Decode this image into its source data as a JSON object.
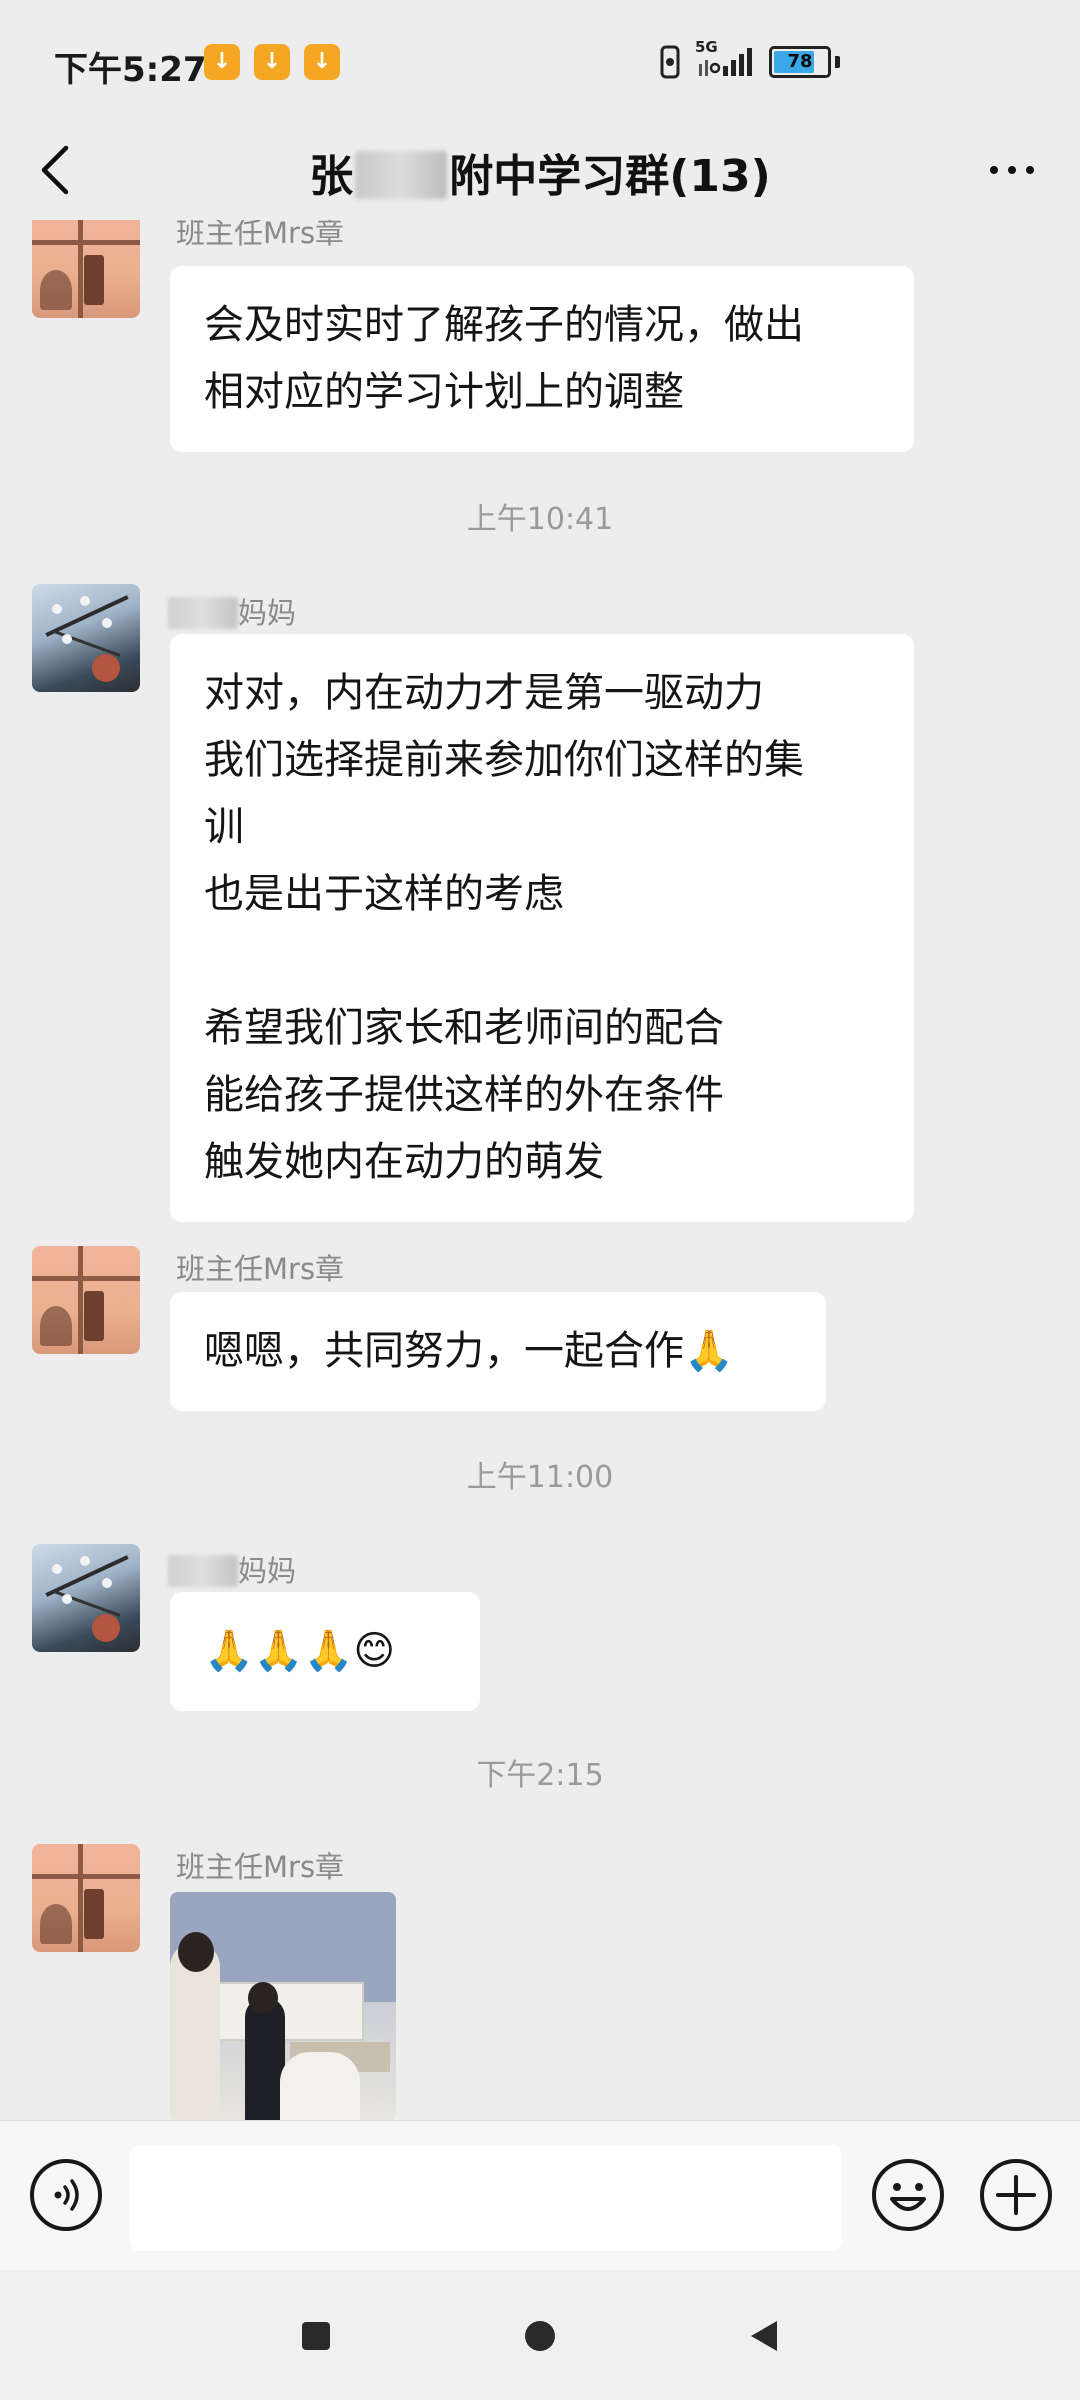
{
  "status_bar": {
    "time": "下午5:27",
    "notification_icons": [
      "notification-icon",
      "notification-icon",
      "notification-icon"
    ],
    "network": "5G",
    "battery": 78
  },
  "header": {
    "title_prefix": "张",
    "title_suffix": "附中学习群(13)"
  },
  "messages": [
    {
      "sender": "班主任Mrs章",
      "avatar": "teacher-avatar",
      "lines": [
        "会及时实时了解孩子的情况，做出",
        "相对应的学习计划上的调整"
      ]
    },
    {
      "time": "上午10:41"
    },
    {
      "sender": "妈妈",
      "avatar": "mom-avatar",
      "lines": [
        "对对，内在动力才是第一驱动力",
        "我们选择提前来参加你们这样的集",
        "训",
        "也是出于这样的考虑",
        "",
        "希望我们家长和老师间的配合",
        "能给孩子提供这样的外在条件",
        "触发她内在动力的萌发"
      ]
    },
    {
      "sender": "班主任Mrs章",
      "avatar": "teacher-avatar",
      "lines": [
        "嗯嗯，共同努力，一起合作🙏"
      ]
    },
    {
      "time": "上午11:00"
    },
    {
      "sender": "妈妈",
      "avatar": "mom-avatar",
      "lines": [
        "🙏🙏🙏😊"
      ]
    },
    {
      "time": "下午2:15"
    },
    {
      "sender": "班主任Mrs章",
      "avatar": "teacher-avatar",
      "image": "classroom-photo"
    }
  ],
  "input": {
    "placeholder": ""
  },
  "nav": [
    "recents-icon",
    "home-icon",
    "back-icon"
  ]
}
